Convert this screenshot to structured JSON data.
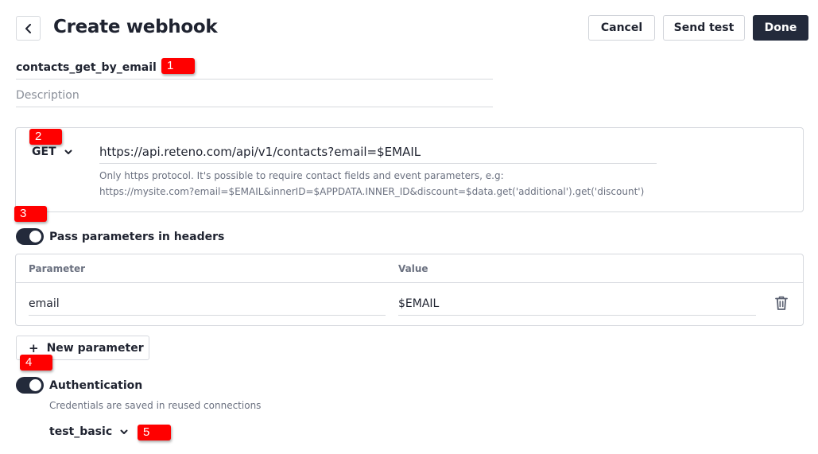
{
  "header": {
    "title": "Create webhook",
    "back_icon": "chevron-left-icon",
    "cancel_label": "Cancel",
    "send_test_label": "Send test",
    "done_label": "Done"
  },
  "webhook": {
    "name": "contacts_get_by_email",
    "description_placeholder": "Description"
  },
  "request": {
    "method": "GET",
    "method_icon": "chevron-down-icon",
    "url": "https://api.reteno.com/api/v1/contacts?email=$EMAIL",
    "hint_line1": "Only https protocol. It's possible to require contact fields and event parameters, e.g:",
    "hint_line2": "https://mysite.com?email=$EMAIL&innerID=$APPDATA.INNER_ID&discount=$data.get('additional').get('discount')"
  },
  "headers": {
    "toggle_on": true,
    "toggle_label": "Pass parameters in headers",
    "columns": [
      "Parameter",
      "Value"
    ],
    "rows": [
      {
        "parameter": "email",
        "value": "$EMAIL",
        "delete_icon": "trash-icon"
      }
    ],
    "add_label": "New parameter",
    "add_icon": "+"
  },
  "authentication": {
    "toggle_on": true,
    "toggle_label": "Authentication",
    "note": "Credentials are saved in reused connections",
    "selected_connection": "test_basic"
  },
  "annotations": [
    "1",
    "2",
    "3",
    "4",
    "5"
  ],
  "colors": {
    "primary_dark": "#232a3b",
    "badge_red": "#ff0000",
    "border": "#d6d9de",
    "muted_text": "#6b7180"
  }
}
